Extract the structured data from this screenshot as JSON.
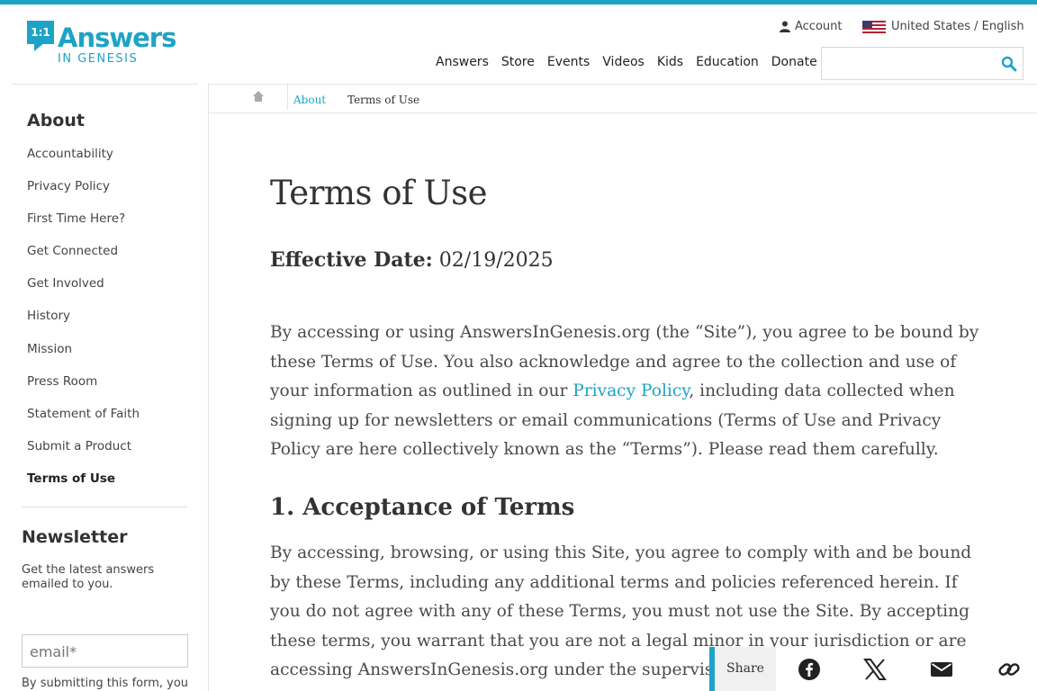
{
  "header": {
    "logo_mark": "1:1",
    "logo_title": "Answers",
    "logo_subtitle": "IN GENESIS",
    "account_label": "Account",
    "language_label": "United States / English",
    "nav": [
      "Answers",
      "Store",
      "Events",
      "Videos",
      "Kids",
      "Education",
      "Donate"
    ],
    "search_placeholder": ""
  },
  "breadcrumb": {
    "parent": "About",
    "current": "Terms of Use"
  },
  "sidebar": {
    "title": "About",
    "items": [
      "Accountability",
      "Privacy Policy",
      "First Time Here?",
      "Get Connected",
      "Get Involved",
      "History",
      "Mission",
      "Press Room",
      "Statement of Faith",
      "Submit a Product",
      "Terms of Use"
    ],
    "active_item": "Terms of Use"
  },
  "newsletter": {
    "title": "Newsletter",
    "description": "Get the latest answers emailed to you.",
    "email_placeholder": "email*",
    "consent_text": "By submitting this form, you"
  },
  "main": {
    "title": "Terms of Use",
    "effective_label": "Effective Date:",
    "effective_date": "02/19/2025",
    "intro_before_link": "By accessing or using AnswersInGenesis.org (the “Site”), you agree to be bound by these Terms of Use. You also acknowledge and agree to the collection and use of your information as outlined in our ",
    "intro_link": "Privacy Policy",
    "intro_after_link": ", including data collected when signing up for newsletters or email communications (Terms of Use and Privacy Policy are here collectively known as the “Terms”). Please read them carefully.",
    "section1_heading": "1. Acceptance of Terms",
    "section1_text": "By accessing, browsing, or using this Site, you agree to comply with and be bound by these Terms, including any additional terms and policies referenced herein. If you do not agree with any of these Terms, you must not use the Site. By accepting these terms, you warrant that you are not a legal minor in your jurisdiction or are accessing AnswersInGenesis.org under the supervisi"
  },
  "share": {
    "label": "Share",
    "buttons": [
      "facebook-icon",
      "x-icon",
      "email-icon",
      "link-icon"
    ]
  },
  "colors": {
    "accent": "#1ea3c6",
    "text": "#4a4a4a"
  }
}
